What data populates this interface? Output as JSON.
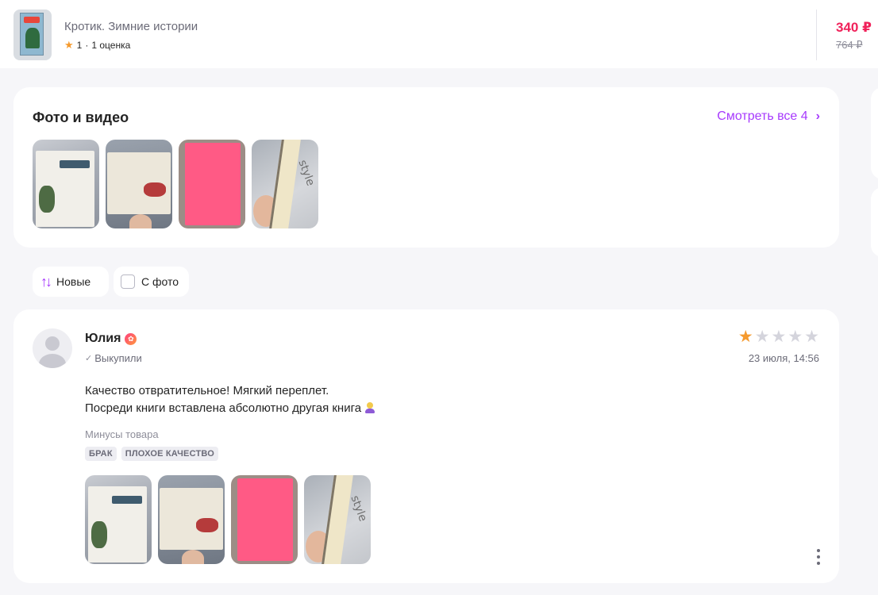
{
  "product": {
    "title": "Кротик. Зимние истории",
    "rating_value": "1",
    "rating_separator": "·",
    "rating_count": "1 оценка",
    "price": "340 ₽",
    "old_price": "764 ₽"
  },
  "photos_section": {
    "title": "Фото и видео",
    "see_all_label": "Смотреть все 4"
  },
  "filters": {
    "sort_label": "Новые",
    "with_photo_label": "С фото",
    "with_photo_checked": false
  },
  "review": {
    "author": "Юлия",
    "status": "Выкупили",
    "rating": 1,
    "rating_max": 5,
    "date": "23 июля, 14:56",
    "text_line1": "Качество отвратительное! Мягкий переплет.",
    "text_line2": "Посреди книги вставлена абсолютно другая книга",
    "cons_label": "Минусы товара",
    "tags": [
      "БРАК",
      "ПЛОХОЕ КАЧЕСТВО"
    ]
  },
  "colors": {
    "accent": "#a73afd",
    "price": "#f0215a",
    "star": "#f59a2e"
  }
}
